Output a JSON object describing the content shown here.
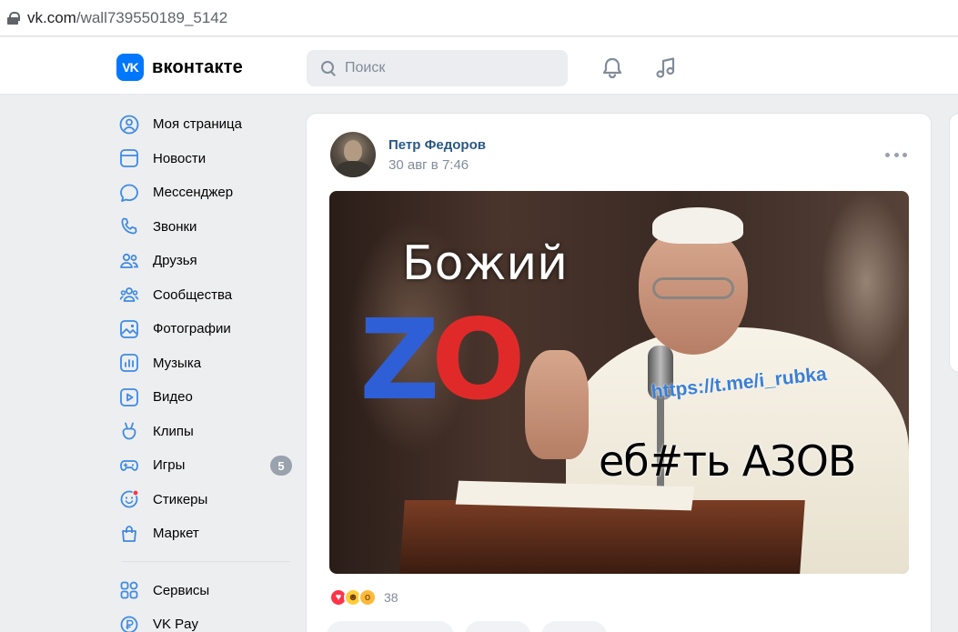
{
  "browser": {
    "url_host": "vk.com",
    "url_path": "/wall739550189_5142"
  },
  "header": {
    "logo_mark": "VK",
    "logo_text": "вконтакте",
    "search_placeholder": "Поиск"
  },
  "sidebar": {
    "items": [
      {
        "label": "Моя страница",
        "icon": "user-circle-icon"
      },
      {
        "label": "Новости",
        "icon": "news-icon"
      },
      {
        "label": "Мессенджер",
        "icon": "message-icon"
      },
      {
        "label": "Звонки",
        "icon": "phone-icon"
      },
      {
        "label": "Друзья",
        "icon": "friends-icon"
      },
      {
        "label": "Сообщества",
        "icon": "communities-icon"
      },
      {
        "label": "Фотографии",
        "icon": "photo-icon"
      },
      {
        "label": "Музыка",
        "icon": "music-icon"
      },
      {
        "label": "Видео",
        "icon": "video-icon"
      },
      {
        "label": "Клипы",
        "icon": "clips-icon"
      },
      {
        "label": "Игры",
        "icon": "gamepad-icon",
        "badge": "5"
      },
      {
        "label": "Стикеры",
        "icon": "sticker-icon"
      },
      {
        "label": "Маркет",
        "icon": "market-icon"
      }
    ],
    "items2": [
      {
        "label": "Сервисы",
        "icon": "services-icon"
      },
      {
        "label": "VK Pay",
        "icon": "vkpay-icon"
      }
    ]
  },
  "post": {
    "author": "Петр Федоров",
    "time": "30 авг в 7:46",
    "image_text": {
      "line1": "Божий",
      "z": "Z",
      "o": "O",
      "link": "https://t.me/i_rubka",
      "bottom": "еб#ть АЗОВ"
    },
    "reactions_count": "38"
  },
  "colors": {
    "accent": "#0077ff",
    "link": "#2a5885",
    "muted": "#818c99",
    "bg": "#edeef0"
  }
}
